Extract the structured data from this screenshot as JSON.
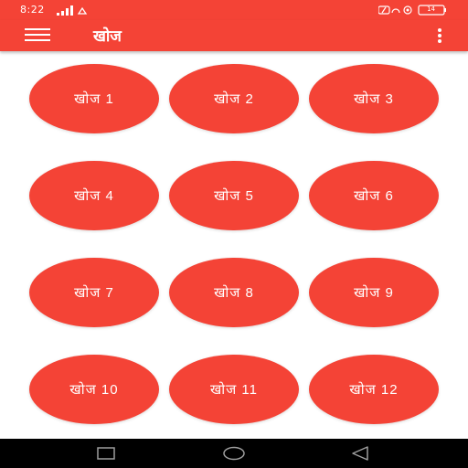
{
  "status_bar": {
    "time": "8:22",
    "battery": "14"
  },
  "app_bar": {
    "title": "खोज"
  },
  "buttons": [
    {
      "label": "खोज 1"
    },
    {
      "label": "खोज 2"
    },
    {
      "label": "खोज 3"
    },
    {
      "label": "खोज 4"
    },
    {
      "label": "खोज 5"
    },
    {
      "label": "खोज 6"
    },
    {
      "label": "खोज 7"
    },
    {
      "label": "खोज 8"
    },
    {
      "label": "खोज 9"
    },
    {
      "label": "खोज 10"
    },
    {
      "label": "खोज 11"
    },
    {
      "label": "खोज 12"
    }
  ],
  "colors": {
    "primary": "#f44336",
    "background": "#ffffff",
    "nav_bar": "#000000"
  },
  "icons": {
    "menu": "hamburger-menu-icon",
    "more": "overflow-menu-icon",
    "nav_back": "back-triangle-icon",
    "nav_home": "home-circle-icon",
    "nav_recent": "recent-apps-square-icon"
  }
}
